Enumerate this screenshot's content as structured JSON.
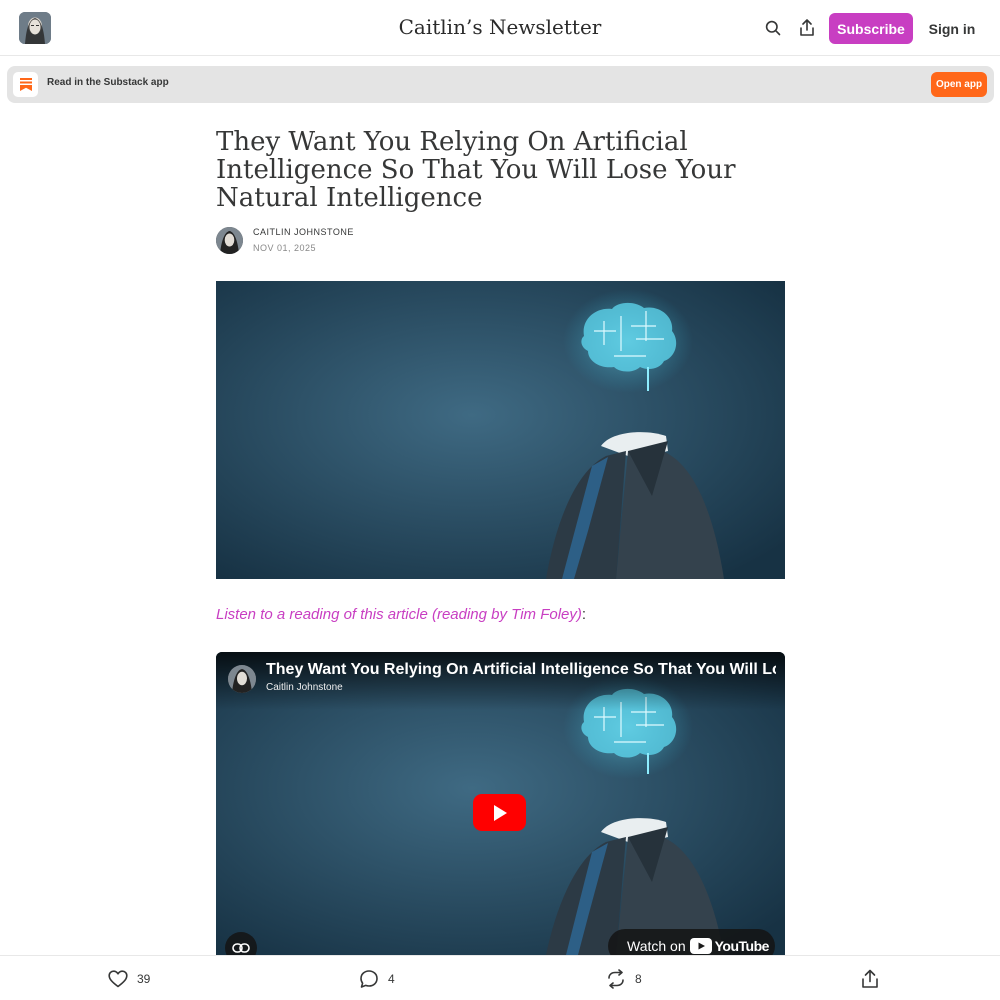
{
  "header": {
    "publication_title": "Caitlin’s Newsletter",
    "subscribe_label": "Subscribe",
    "sign_in_label": "Sign in"
  },
  "app_banner": {
    "text": "Read in the Substack app",
    "button_label": "Open app"
  },
  "article": {
    "title": "They Want You Relying On Artificial Intelligence So That You Will Lose Your Natural Intelligence",
    "author": "CAITLIN JOHNSTONE",
    "date": "NOV 01, 2025",
    "listen_link": "Listen to a reading of this article (reading by Tim Foley)",
    "listen_suffix": ":"
  },
  "video": {
    "title": "They Want You Relying On Artificial Intelligence So That You Will Lose Yo",
    "channel": "Caitlin Johnstone",
    "watch_on_label": "Watch on",
    "youtube_wordmark": "YouTube"
  },
  "bottom_bar": {
    "likes": "39",
    "comments": "4",
    "restacks": "8"
  },
  "colors": {
    "accent": "#c83ec2",
    "substack_orange": "#ff6719",
    "youtube_red": "#ff0000"
  }
}
